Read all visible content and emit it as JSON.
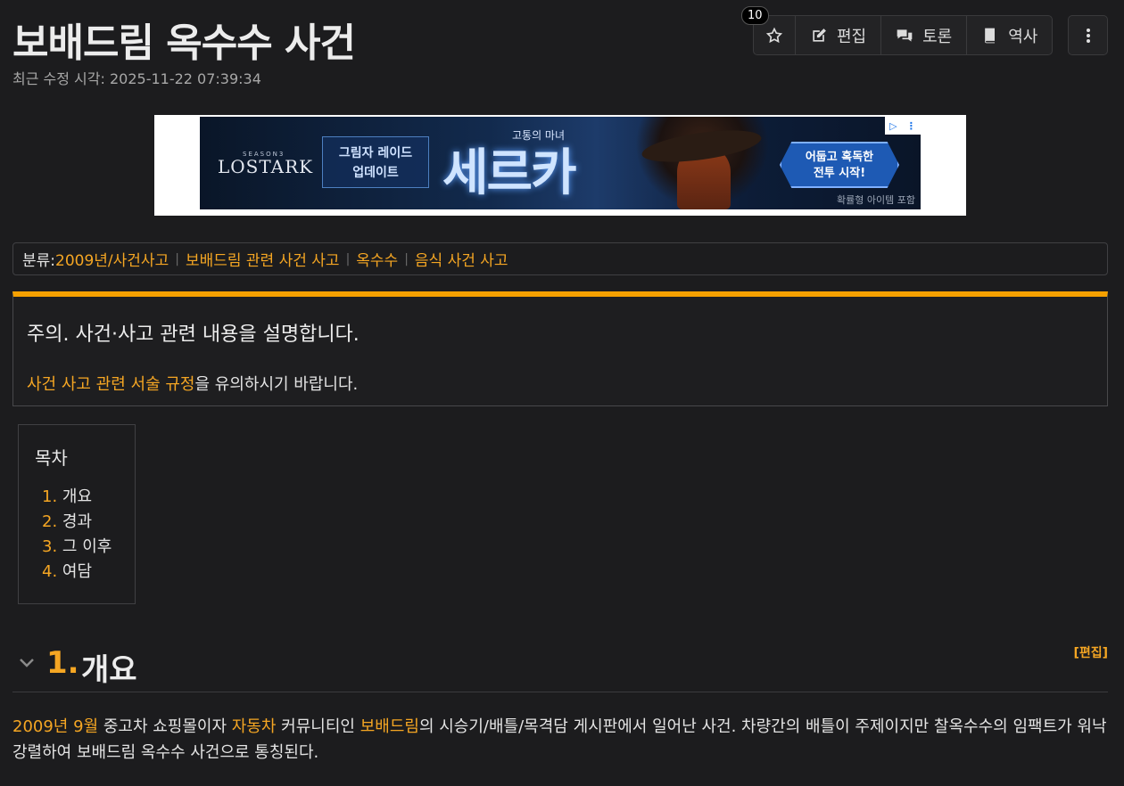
{
  "header": {
    "title": "보배드림 옥수수 사건",
    "last_modified_label": "최근 수정 시각:",
    "last_modified_value": "2025-11-22 07:39:34",
    "star_count": "10",
    "edit_label": "편집",
    "discuss_label": "토론",
    "history_label": "역사"
  },
  "ad": {
    "brand": "LOSTARK",
    "brand_small": "SEASON3",
    "box_line1": "그림자 레이드",
    "box_line2": "업데이트",
    "subtitle": "고통의 마녀",
    "headline": "세르카",
    "cta_line1": "어둡고 혹독한",
    "cta_line2": "전투 시작!",
    "note": "확률형 아이템 포함"
  },
  "categories": {
    "label": "분류:",
    "items": [
      "2009년/사건사고",
      "보배드림 관련 사건 사고",
      "옥수수",
      "음식 사건 사고"
    ]
  },
  "notice": {
    "title": "주의. 사건·사고 관련 내용을 설명합니다.",
    "link_text": "사건 사고 관련 서술 규정",
    "body_suffix": "을 유의하시기 바랍니다."
  },
  "toc": {
    "title": "목차",
    "items": [
      {
        "num": "1",
        "label": "개요"
      },
      {
        "num": "2",
        "label": "경과"
      },
      {
        "num": "3",
        "label": "그 이후"
      },
      {
        "num": "4",
        "label": "여담"
      }
    ]
  },
  "section1": {
    "num": "1.",
    "title": "개요",
    "edit_label": "[편집]",
    "parts": [
      {
        "text": "2009년 9월",
        "link": true
      },
      {
        "text": " 중고차 쇼핑몰이자 ",
        "link": false
      },
      {
        "text": "자동차",
        "link": true
      },
      {
        "text": " 커뮤니티인 ",
        "link": false
      },
      {
        "text": "보배드림",
        "link": true
      },
      {
        "text": "의 시승기/배틀/목격담 게시판에서 일어난 사건. 차량간의 배틀이 주제이지만 찰옥수수의 임팩트가 워낙 강렬하여 보배드림 옥수수 사건으로 통칭된다.",
        "link": false
      }
    ]
  },
  "colors": {
    "accent": "#f5a623",
    "notice_bar": "#f5a000",
    "background": "#1c1c1e"
  }
}
